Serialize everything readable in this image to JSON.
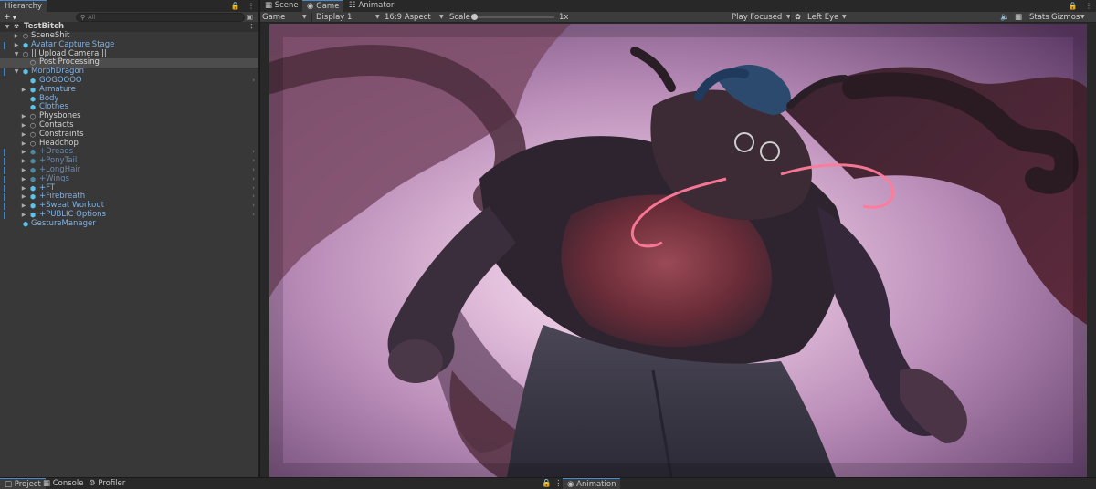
{
  "hierarchy": {
    "tab_label": "Hierarchy",
    "add_label": "+",
    "search_placeholder": "All",
    "items": [
      {
        "label": "TestBitch"
      },
      {
        "label": "SceneShit"
      },
      {
        "label": "Avatar Capture Stage"
      },
      {
        "label": "|| Upload Camera ||"
      },
      {
        "label": "Post Processing"
      },
      {
        "label": "MorphDragon"
      },
      {
        "label": "GOGOOOO"
      },
      {
        "label": "Armature"
      },
      {
        "label": "Body"
      },
      {
        "label": "Clothes"
      },
      {
        "label": "Physbones"
      },
      {
        "label": "Contacts"
      },
      {
        "label": "Constraints"
      },
      {
        "label": "Headchop"
      },
      {
        "label": "+Dreads"
      },
      {
        "label": "+PonyTail"
      },
      {
        "label": "+LongHair"
      },
      {
        "label": "+Wings"
      },
      {
        "label": "+FT"
      },
      {
        "label": "+Firebreath"
      },
      {
        "label": "+Sweat Workout"
      },
      {
        "label": "+PUBLIC Options"
      },
      {
        "label": "GestureManager"
      }
    ]
  },
  "game_tabs": [
    {
      "label": "Scene",
      "icon": "grid-icon"
    },
    {
      "label": "Game",
      "icon": "gamepad-icon"
    },
    {
      "label": "Animator",
      "icon": "animator-icon"
    }
  ],
  "game_toolbar": {
    "mode": "Game",
    "display": "Display 1",
    "aspect": "16:9 Aspect",
    "scale_label": "Scale",
    "scale_value": "1x",
    "play_mode": "Play Focused",
    "eye": "Left Eye",
    "stats": "Stats",
    "gizmos": "Gizmos"
  },
  "bottom_tabs": {
    "project": "Project",
    "console": "Console",
    "profiler": "Profiler",
    "animation": "Animation"
  },
  "colors": {
    "accent": "#3a84c9",
    "prefab": "#5ec3e8",
    "prefab_text": "#7fb2e6",
    "panel": "#383838"
  }
}
